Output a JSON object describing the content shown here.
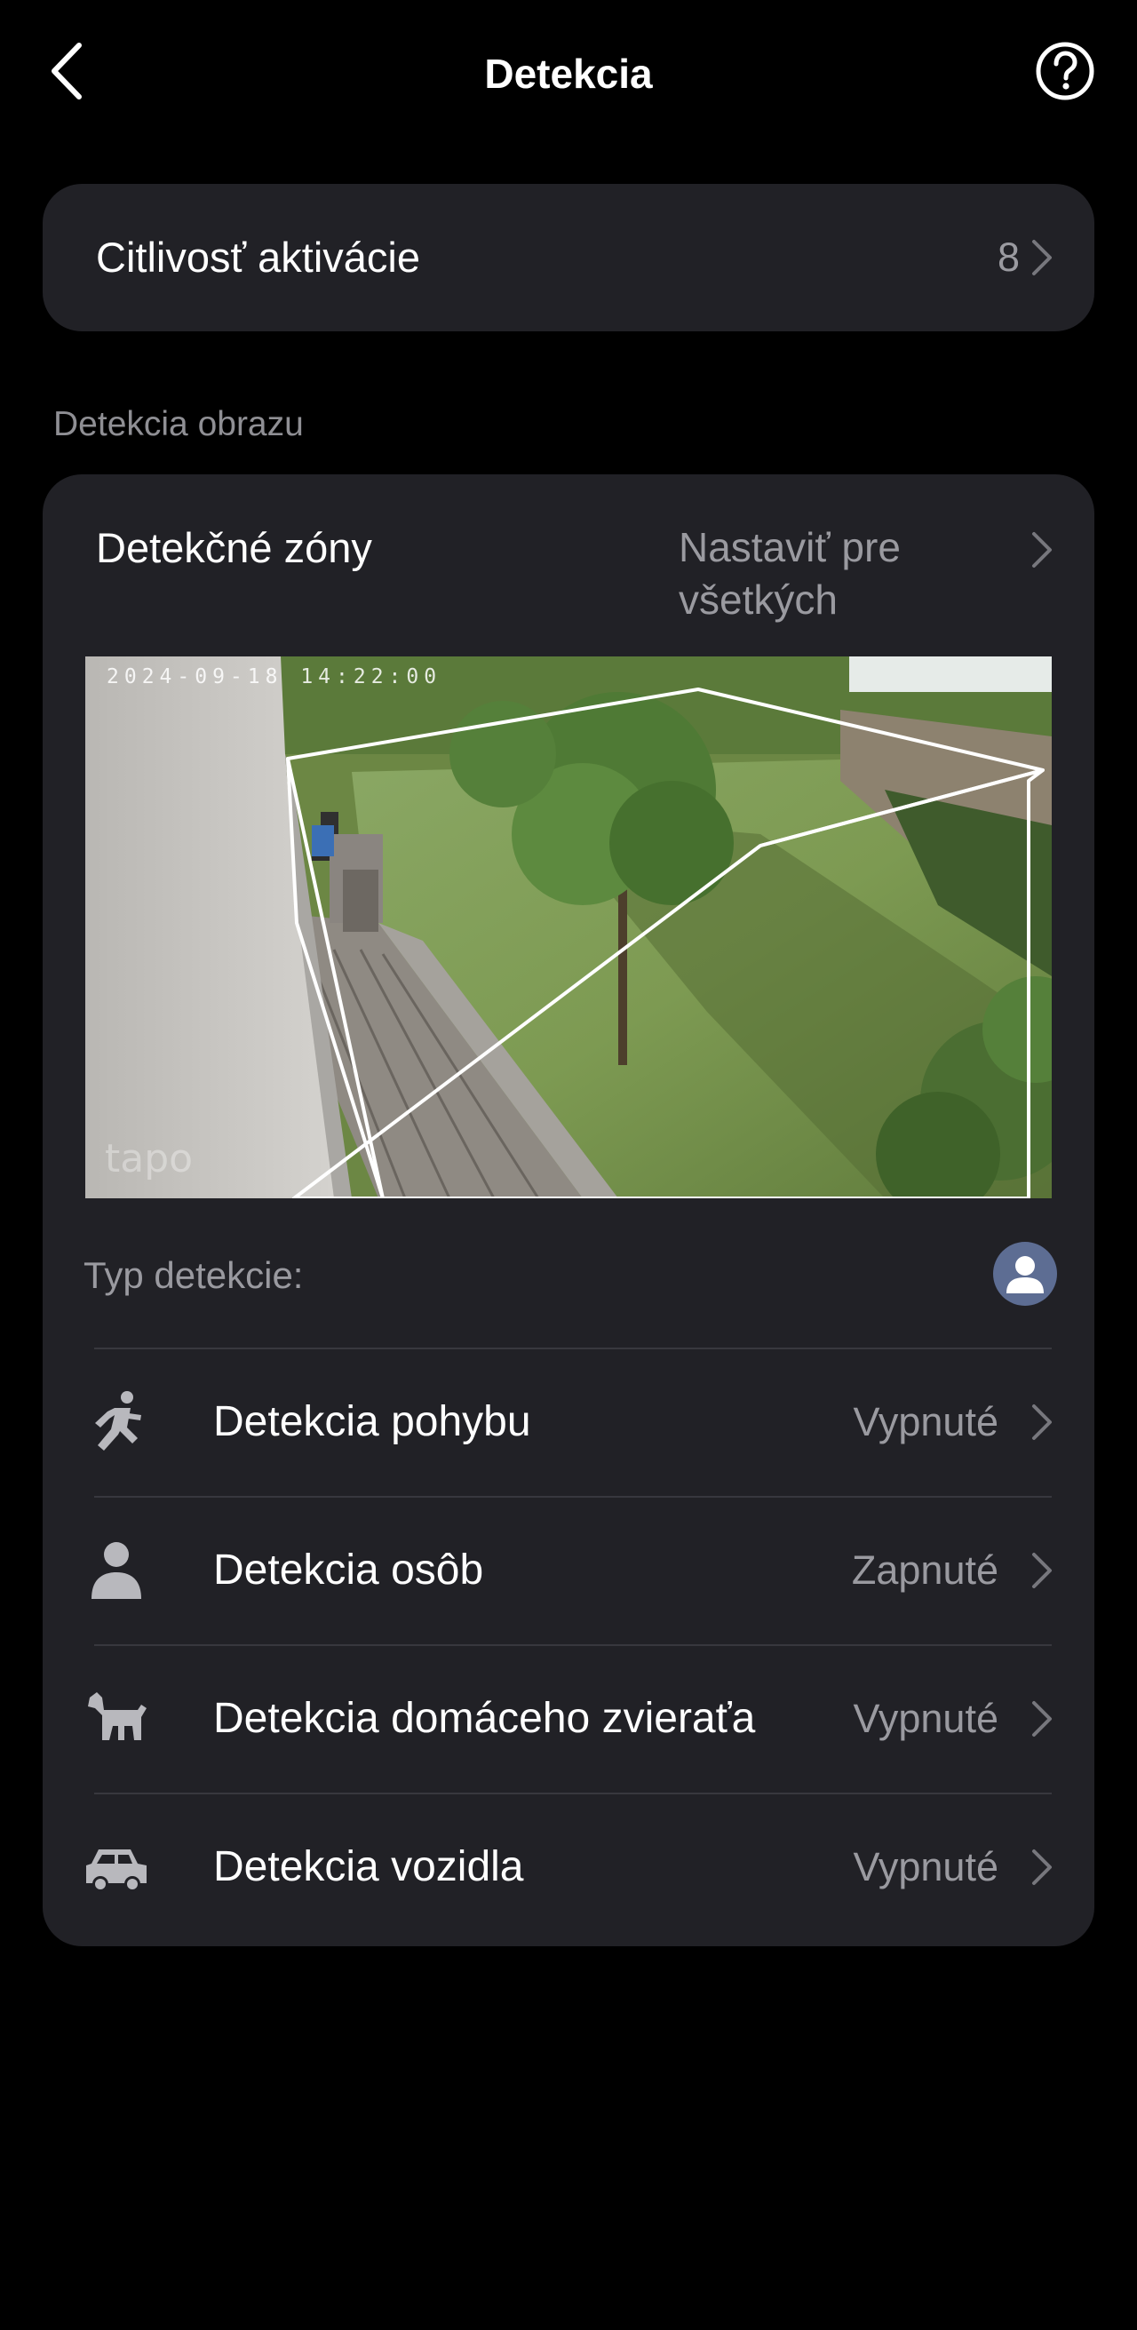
{
  "header": {
    "title": "Detekcia",
    "back_icon": "chevron-left-icon",
    "help_icon": "help-circle-icon"
  },
  "sensitivity": {
    "label": "Citlivosť aktivácie",
    "value": "8"
  },
  "section": {
    "label": "Detekcia obrazu"
  },
  "zones": {
    "label": "Detekčné zóny",
    "value": "Nastaviť pre všetkých",
    "preview": {
      "timestamp": "2024-09-18 14:22:00",
      "watermark": "tapo"
    }
  },
  "detection_type": {
    "label": "Typ detekcie:",
    "icon": "person-avatar-icon"
  },
  "detections": [
    {
      "icon": "running-person-icon",
      "label": "Detekcia pohybu",
      "status": "Vypnuté"
    },
    {
      "icon": "person-icon",
      "label": "Detekcia osôb",
      "status": "Zapnuté"
    },
    {
      "icon": "dog-icon",
      "label": "Detekcia domáceho zvieraťa",
      "status": "Vypnuté"
    },
    {
      "icon": "car-icon",
      "label": "Detekcia vozidla",
      "status": "Vypnuté"
    }
  ],
  "colors": {
    "background": "#000000",
    "card": "#212126",
    "secondary_text": "#9a9aa0",
    "avatar": "#5d6d93"
  }
}
